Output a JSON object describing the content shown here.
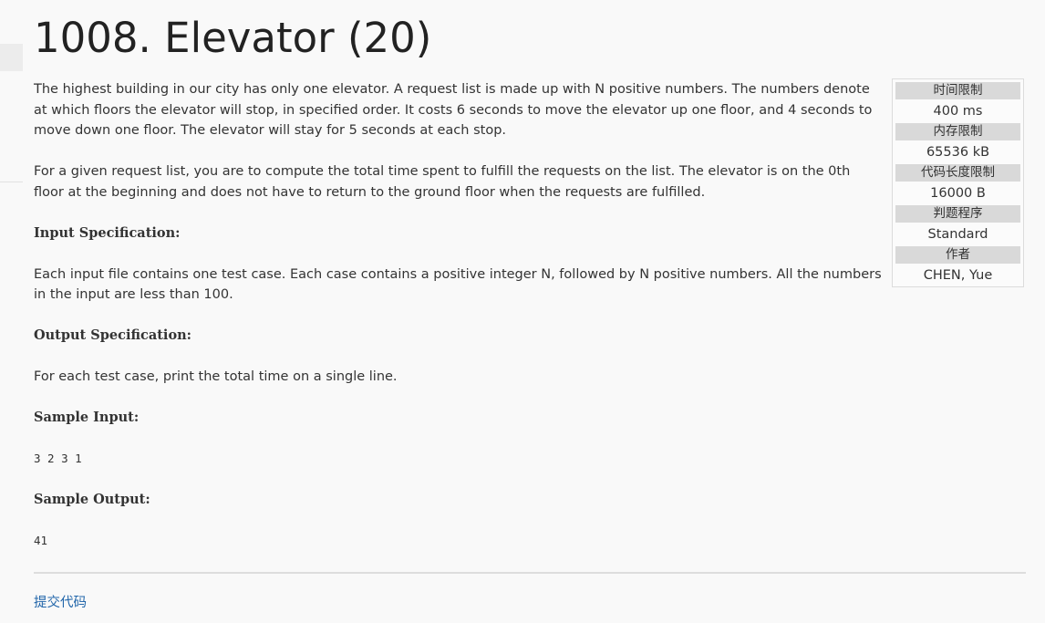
{
  "problem": {
    "title": "1008. Elevator (20)",
    "description": [
      "The highest building in our city has only one elevator. A request list is made up with N positive numbers. The numbers denote at which floors the elevator will stop, in specified order. It costs 6 seconds to move the elevator up one floor, and 4 seconds to move down one floor. The elevator will stay for 5 seconds at each stop.",
      "For a given request list, you are to compute the total time spent to fulfill the requests on the list. The elevator is on the 0th floor at the beginning and does not have to return to the ground floor when the requests are fulfilled."
    ],
    "input_spec": {
      "heading": "Input Specification:",
      "text": "Each input file contains one test case. Each case contains a positive integer N, followed by N positive numbers. All the numbers in the input are less than 100."
    },
    "output_spec": {
      "heading": "Output Specification:",
      "text": "For each test case, print the total time on a single line."
    },
    "sample_input": {
      "heading": "Sample Input:",
      "text": "3 2 3 1"
    },
    "sample_output": {
      "heading": "Sample Output:",
      "text": "41"
    }
  },
  "limits": [
    {
      "label": "时间限制",
      "value": "400 ms"
    },
    {
      "label": "内存限制",
      "value": "65536 kB"
    },
    {
      "label": "代码长度限制",
      "value": "16000 B"
    },
    {
      "label": "判题程序",
      "value": "Standard"
    },
    {
      "label": "作者",
      "value": "CHEN, Yue"
    }
  ],
  "footer": {
    "submit_label": "提交代码"
  },
  "colors": {
    "link": "#2266aa",
    "label_bg": "#d9d9d9",
    "page_bg": "#f9f9f9"
  }
}
